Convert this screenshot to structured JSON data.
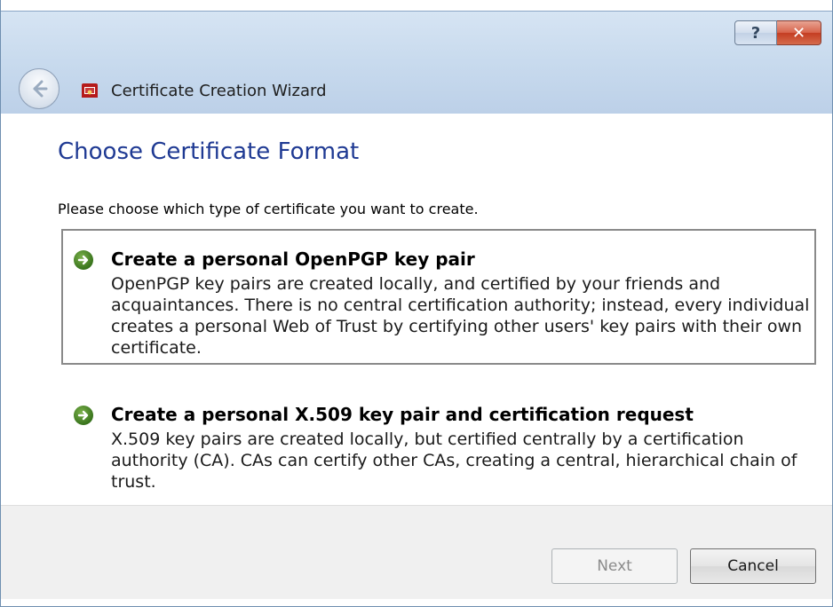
{
  "window": {
    "help_label": "?",
    "close_label": "✕",
    "title": "Certificate Creation Wizard"
  },
  "page": {
    "heading": "Choose Certificate Format",
    "instruction": "Please choose which type of certificate you want to create."
  },
  "options": [
    {
      "title": "Create a personal OpenPGP key pair",
      "description": "OpenPGP key pairs are created locally, and certified by your friends and acquaintances. There is no central certification authority; instead, every individual creates a personal Web of Trust by certifying other users' key pairs with their own certificate."
    },
    {
      "title": "Create a personal X.509 key pair and certification request",
      "description": "X.509 key pairs are created locally, but certified centrally by a certification authority (CA). CAs can certify other CAs, creating a central, hierarchical chain of trust."
    }
  ],
  "footer": {
    "next_label": "Next",
    "cancel_label": "Cancel"
  },
  "colors": {
    "heading": "#1f3a93",
    "arrow_icon": "#3d7d1f",
    "close_button": "#c9462b"
  },
  "icons": {
    "back": "back-arrow-icon",
    "app": "kleopatra-certificate-icon",
    "option": "green-arrow-icon"
  }
}
